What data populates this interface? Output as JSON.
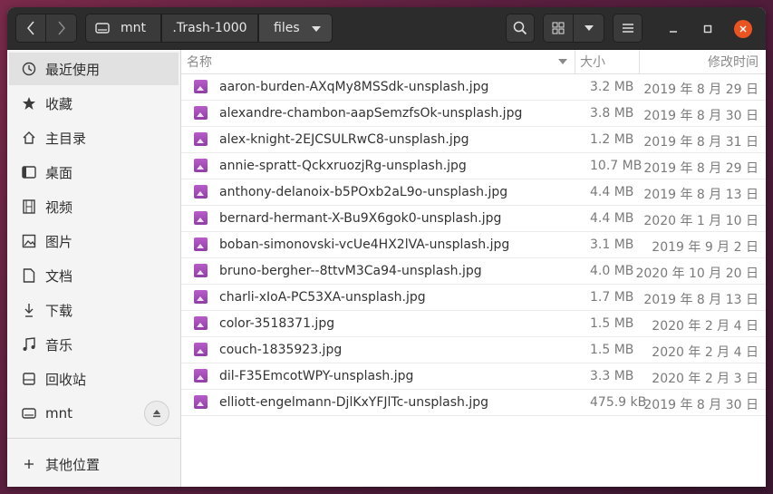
{
  "nav": {
    "back_icon": "chevron-left-icon",
    "forward_icon": "chevron-right-icon"
  },
  "path": {
    "segments": [
      "mnt",
      ".Trash-1000",
      "files"
    ]
  },
  "sidebar": {
    "items": [
      {
        "label": "最近使用",
        "icon": "clock-icon"
      },
      {
        "label": "收藏",
        "icon": "star-icon"
      },
      {
        "label": "主目录",
        "icon": "home-icon"
      },
      {
        "label": "桌面",
        "icon": "desktop-icon"
      },
      {
        "label": "视频",
        "icon": "video-icon"
      },
      {
        "label": "图片",
        "icon": "picture-icon"
      },
      {
        "label": "文档",
        "icon": "document-icon"
      },
      {
        "label": "下载",
        "icon": "download-icon"
      },
      {
        "label": "音乐",
        "icon": "music-icon"
      },
      {
        "label": "回收站",
        "icon": "trash-icon"
      },
      {
        "label": "mnt",
        "icon": "drive-icon"
      },
      {
        "label": "其他位置",
        "icon": "plus-icon"
      }
    ]
  },
  "columns": {
    "name": "名称",
    "size": "大小",
    "modified": "修改时间"
  },
  "files": [
    {
      "name": "aaron-burden-AXqMy8MSSdk-unsplash.jpg",
      "size": "3.2 MB",
      "date": "2019 年 8 月 29 日"
    },
    {
      "name": "alexandre-chambon-aapSemzfsOk-unsplash.jpg",
      "size": "3.8 MB",
      "date": "2019 年 8 月 30 日"
    },
    {
      "name": "alex-knight-2EJCSULRwC8-unsplash.jpg",
      "size": "1.2 MB",
      "date": "2019 年 8 月 31 日"
    },
    {
      "name": "annie-spratt-QckxruozjRg-unsplash.jpg",
      "size": "10.7 MB",
      "date": "2019 年 8 月 29 日"
    },
    {
      "name": "anthony-delanoix-b5POxb2aL9o-unsplash.jpg",
      "size": "4.4 MB",
      "date": "2019 年 8 月 13 日"
    },
    {
      "name": "bernard-hermant-X-Bu9X6gok0-unsplash.jpg",
      "size": "4.4 MB",
      "date": "2020 年 1 月 10 日"
    },
    {
      "name": "boban-simonovski-vcUe4HX2lVA-unsplash.jpg",
      "size": "3.1 MB",
      "date": "2019 年 9 月 2 日"
    },
    {
      "name": "bruno-bergher--8ttvM3Ca94-unsplash.jpg",
      "size": "4.0 MB",
      "date": "2020 年 10 月 20 日"
    },
    {
      "name": "charli-xIoA-PC53XA-unsplash.jpg",
      "size": "1.7 MB",
      "date": "2019 年 8 月 13 日"
    },
    {
      "name": "color-3518371.jpg",
      "size": "1.5 MB",
      "date": "2020 年 2 月 4 日"
    },
    {
      "name": "couch-1835923.jpg",
      "size": "1.5 MB",
      "date": "2020 年 2 月 4 日"
    },
    {
      "name": "dil-F35EmcotWPY-unsplash.jpg",
      "size": "3.3 MB",
      "date": "2020 年 2 月 3 日"
    },
    {
      "name": "elliott-engelmann-DjlKxYFJlTc-unsplash.jpg",
      "size": "475.9 kB",
      "date": "2019 年 8 月 30 日"
    }
  ],
  "colors": {
    "accent": "#e95420",
    "headerbar": "#2c2c2c",
    "image_icon": "#a64dbd"
  }
}
